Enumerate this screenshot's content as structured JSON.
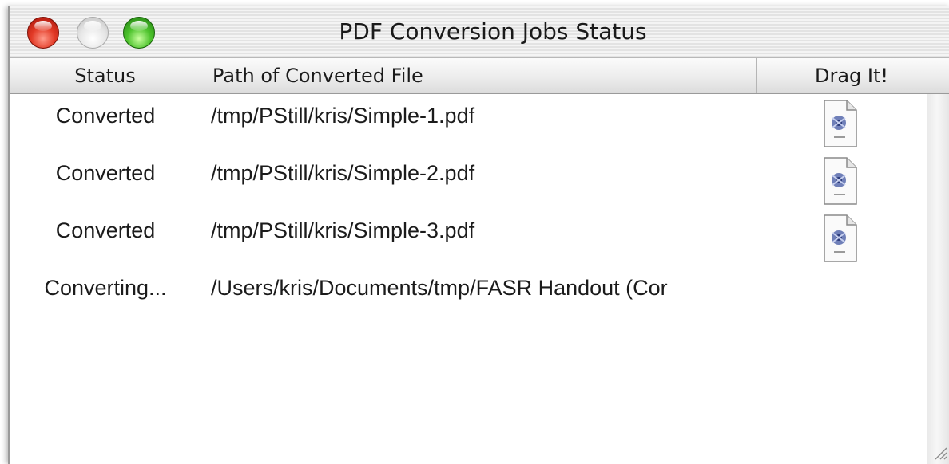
{
  "window": {
    "title": "PDF Conversion Jobs Status"
  },
  "columns": {
    "status": "Status",
    "path": "Path of Converted File",
    "drag": "Drag It!"
  },
  "rows": [
    {
      "status": "Converted",
      "path": "/tmp/PStill/kris/Simple-1.pdf",
      "has_icon": true
    },
    {
      "status": "Converted",
      "path": "/tmp/PStill/kris/Simple-2.pdf",
      "has_icon": true
    },
    {
      "status": "Converted",
      "path": "/tmp/PStill/kris/Simple-3.pdf",
      "has_icon": true
    },
    {
      "status": "Converting...",
      "path": "/Users/kris/Documents/tmp/FASR Handout (Cor",
      "has_icon": false
    }
  ],
  "icons": {
    "close": "close-icon",
    "minimize": "minimize-icon",
    "zoom": "zoom-icon",
    "document": "pdf-document-icon",
    "resize": "resize-grip-icon"
  },
  "colors": {
    "close": "#e23a26",
    "minimize": "#d9d9d9",
    "zoom": "#4cc22c"
  }
}
